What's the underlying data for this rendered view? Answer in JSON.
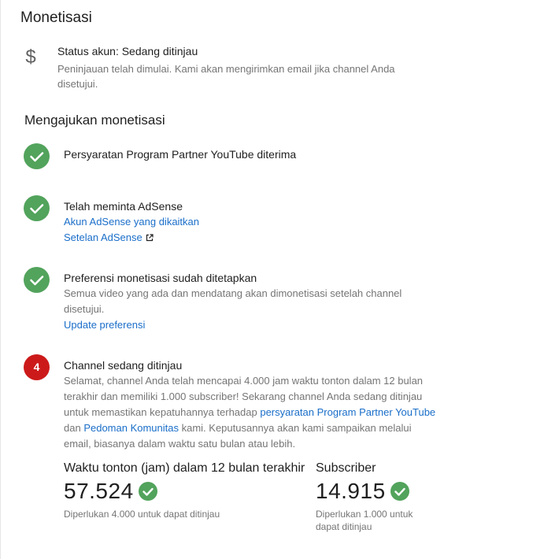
{
  "header": {
    "title": "Monetisasi"
  },
  "status": {
    "icon": "dollar-icon",
    "title": "Status akun: Sedang ditinjau",
    "desc": "Peninjauan telah dimulai. Kami akan mengirimkan email jika channel Anda disetujui."
  },
  "apply": {
    "title": "Mengajukan monetisasi",
    "steps": [
      {
        "state": "done",
        "headline": "Persyaratan Program Partner YouTube diterima"
      },
      {
        "state": "done",
        "headline": "Telah meminta AdSense",
        "links": [
          "Akun AdSense yang dikaitkan",
          "Setelan AdSense"
        ]
      },
      {
        "state": "done",
        "headline": "Preferensi monetisasi sudah ditetapkan",
        "text": "Semua video yang ada dan mendatang akan dimonetisasi setelah channel disetujui.",
        "link": "Update preferensi"
      },
      {
        "state": "pending",
        "number": "4",
        "headline": "Channel sedang ditinjau",
        "text_1": "Selamat, channel Anda telah mencapai 4.000 jam waktu tonton dalam 12 bulan terakhir dan memiliki 1.000 subscriber! Sekarang channel Anda sedang ditinjau untuk memastikan kepatuhannya terhadap ",
        "link_1": "persyaratan Program Partner YouTube",
        "text_2": " dan ",
        "link_2": "Pedoman Komunitas",
        "text_3": " kami. Keputusannya akan kami sampaikan melalui email, biasanya dalam waktu satu bulan atau lebih."
      }
    ]
  },
  "stats": [
    {
      "label": "Waktu tonton (jam) dalam 12 bulan terakhir",
      "value": "57.524",
      "note": "Diperlukan 4.000 untuk dapat ditinjau"
    },
    {
      "label": "Subscriber",
      "value": "14.915",
      "note": "Diperlukan 1.000 untuk dapat ditinjau"
    }
  ],
  "colors": {
    "success": "#52a35c",
    "pending": "#cc1a1a",
    "link": "#1a6ec9"
  }
}
